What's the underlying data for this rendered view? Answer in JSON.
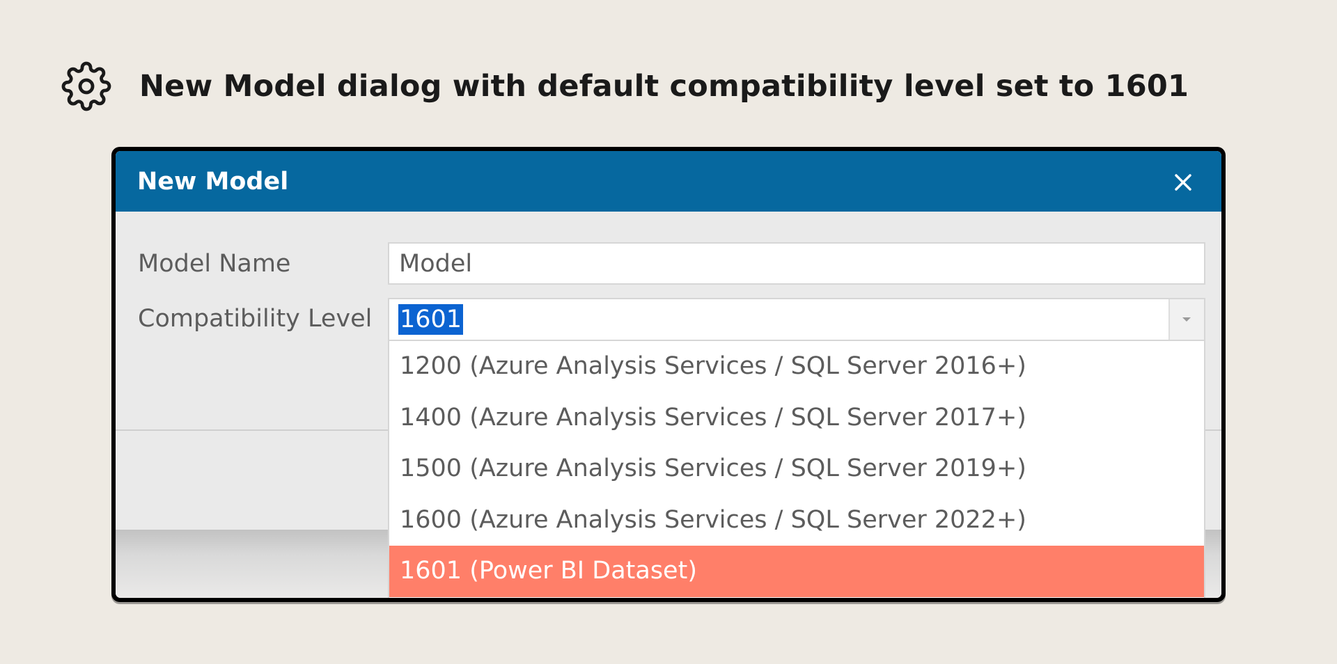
{
  "page": {
    "title": "New Model dialog with default compatibility level set to 1601",
    "icon": "gear-icon"
  },
  "dialog": {
    "title": "New Model",
    "close_icon": "close-icon",
    "titlebar_color": "#06689F",
    "fields": {
      "model_name_label": "Model Name",
      "model_name_value": "Model",
      "compat_label": "Compatibility Level",
      "compat_value": "1601"
    },
    "dropdown": {
      "options": [
        "1200 (Azure Analysis Services / SQL Server 2016+)",
        "1400 (Azure Analysis Services / SQL Server 2017+)",
        "1500 (Azure Analysis Services / SQL Server 2019+)",
        "1600 (Azure Analysis Services / SQL Server 2022+)",
        "1601 (Power BI Dataset)"
      ],
      "selected_index": 4,
      "highlight_color": "#FF7F69",
      "selection_color": "#0B63D1"
    }
  }
}
